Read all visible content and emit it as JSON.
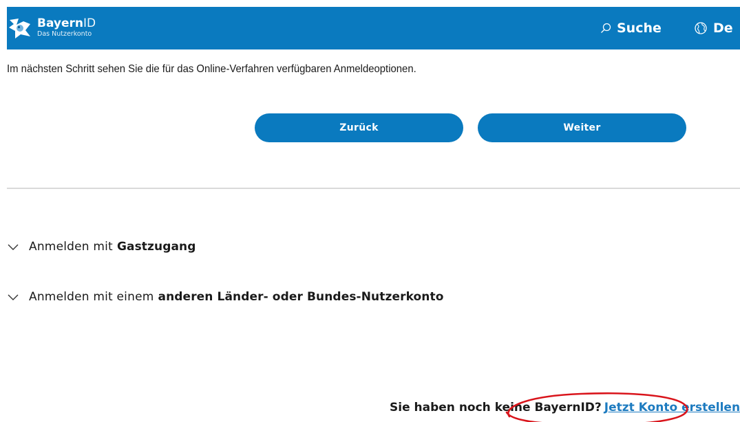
{
  "header": {
    "brand_bold": "Bayern",
    "brand_light": "ID",
    "brand_subtitle": "Das Nutzerkonto",
    "search_label": "Suche",
    "language_label": "De",
    "icons": [
      "logo-icon",
      "search-icon",
      "globe-icon"
    ]
  },
  "main": {
    "intro_text": "Im nächsten Schritt sehen Sie die für das Online-Verfahren verfügbaren Anmeldeoptionen.",
    "back_label": "Zurück",
    "next_label": "Weiter",
    "accordions": [
      {
        "prefix": "Anmelden mit",
        "emphasis": "Gastzugang",
        "icon": "chevron-down-icon"
      },
      {
        "prefix": "Anmelden mit einem",
        "emphasis": "anderen Länder- oder Bundes-Nutzerkonto",
        "icon": "chevron-down-icon"
      }
    ],
    "signup_question": "Sie haben noch keine BayernID?",
    "signup_link": "Jetzt Konto erstellen"
  },
  "colors": {
    "brand_blue": "#0a7abf",
    "link_blue": "#1d7bc0",
    "annotation_red": "#d9141b",
    "divider": "#d9d9d9"
  }
}
